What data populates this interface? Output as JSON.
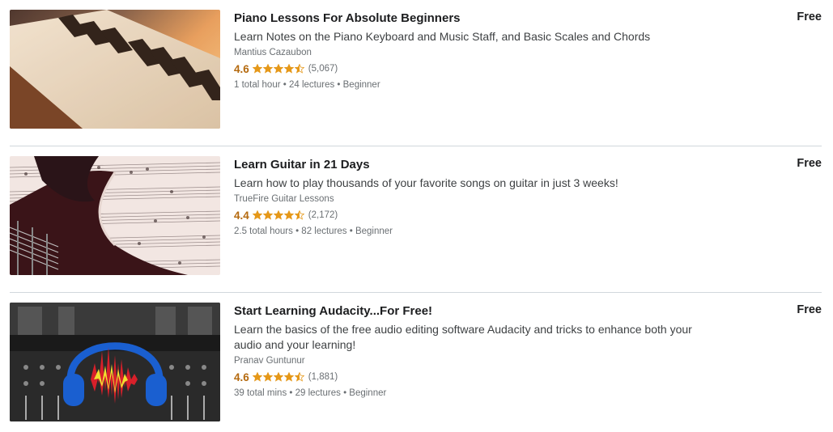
{
  "courses": [
    {
      "title": "Piano Lessons For Absolute Beginners",
      "headline": "Learn Notes on the Piano Keyboard and Music Staff, and Basic Scales and Chords",
      "instructor": "Mantius Cazaubon",
      "rating": "4.6",
      "rating_value": 4.6,
      "count": "(5,067)",
      "meta": "1 total hour • 24 lectures • Beginner",
      "price": "Free",
      "thumb_icon": "piano-keyboard-image"
    },
    {
      "title": "Learn Guitar in 21 Days",
      "headline": "Learn how to play thousands of your favorite songs on guitar in just 3 weeks!",
      "instructor": "TrueFire Guitar Lessons",
      "rating": "4.4",
      "rating_value": 4.4,
      "count": "(2,172)",
      "meta": "2.5 total hours • 82 lectures • Beginner",
      "price": "Free",
      "thumb_icon": "guitar-sheet-music-image"
    },
    {
      "title": "Start Learning Audacity...For Free!",
      "headline": "Learn the basics of the free audio editing software Audacity and tricks to enhance both your audio and your learning!",
      "instructor": "Pranav Guntunur",
      "rating": "4.6",
      "rating_value": 4.6,
      "count": "(1,881)",
      "meta": "39 total mins • 29 lectures • Beginner",
      "price": "Free",
      "thumb_icon": "audacity-headphones-image"
    }
  ],
  "colors": {
    "star": "#e59819",
    "rating": "#b4690e",
    "divider": "#d1d7dc"
  }
}
